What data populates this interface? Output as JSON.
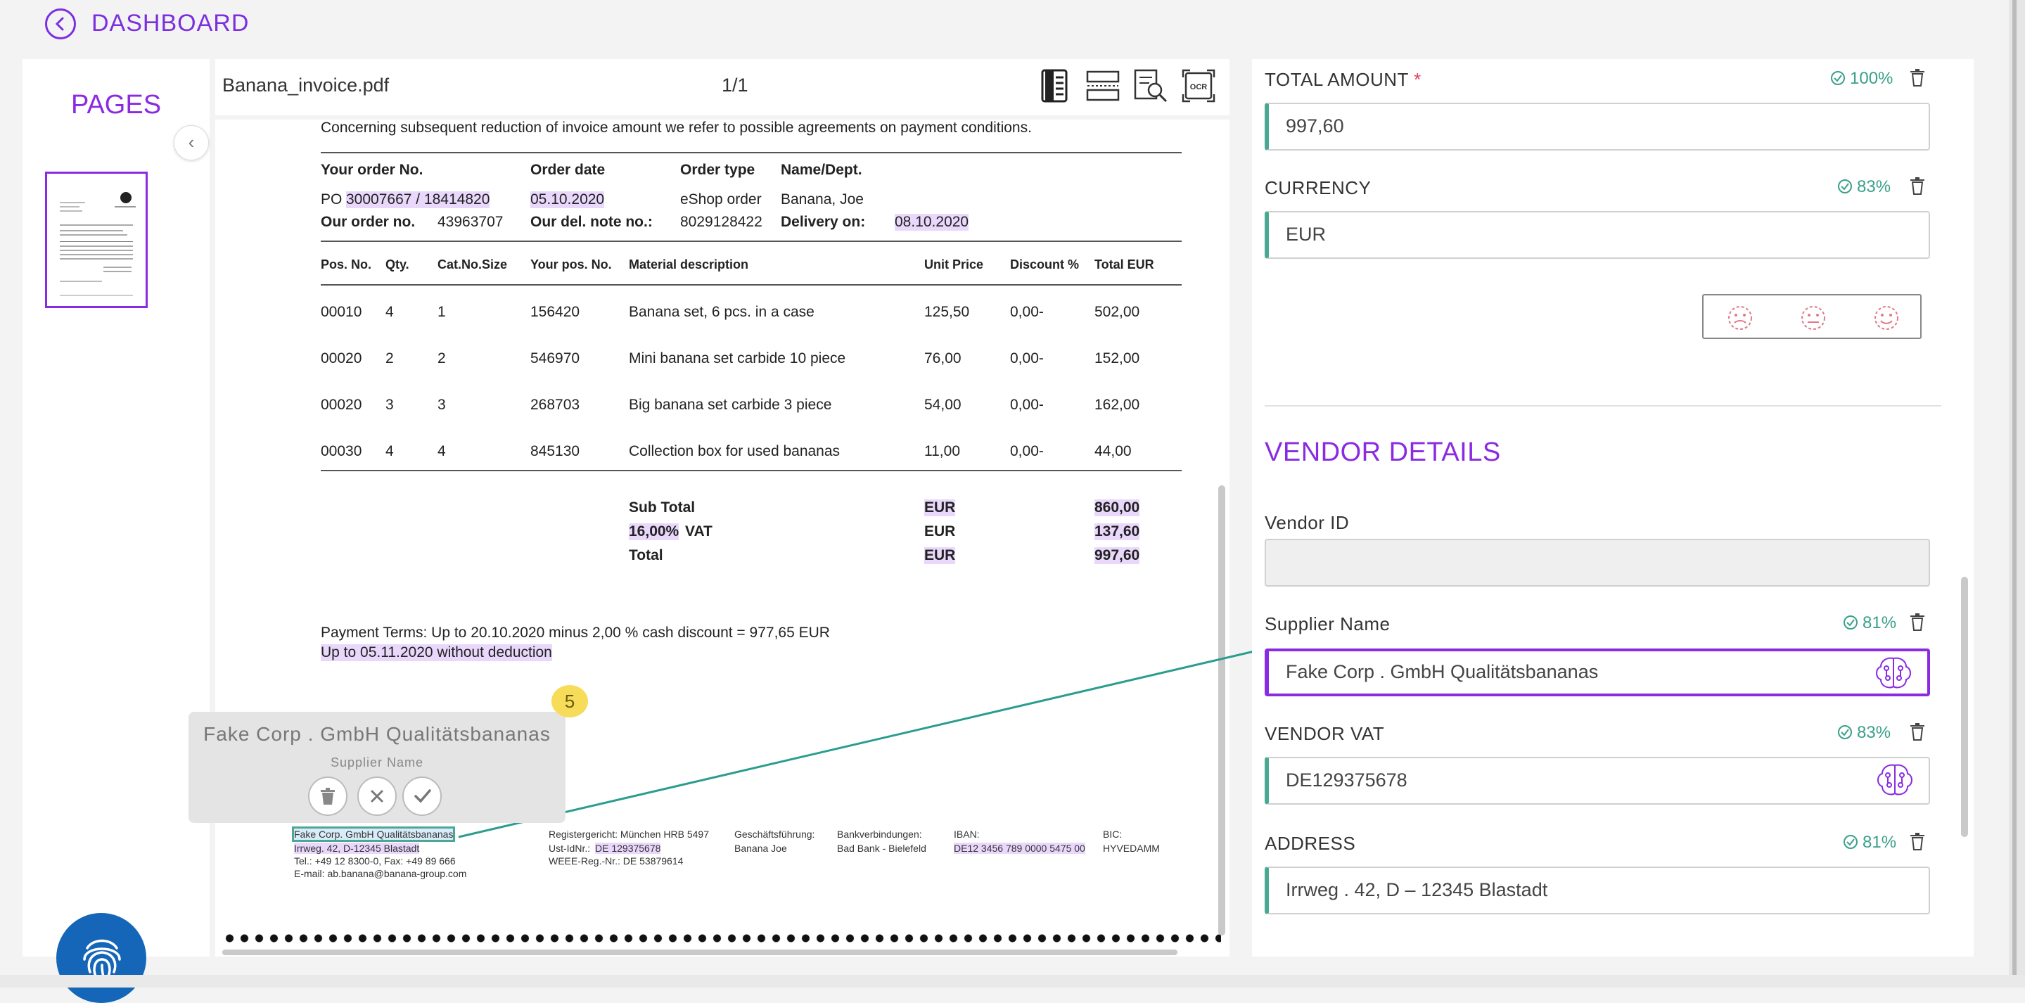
{
  "header": {
    "title": "DASHBOARD"
  },
  "pages_panel": {
    "title": "PAGES"
  },
  "viewer": {
    "file_name": "Banana_invoice.pdf",
    "page_indicator": "1/1"
  },
  "invoice": {
    "top_line": "Concerning subsequent reduction of invoice amount we refer to possible agreements on payment conditions.",
    "order_headers": [
      "Your order No.",
      "Order date",
      "Order type",
      "Name/Dept."
    ],
    "po_prefix": "PO",
    "po_value": "30007667 / 18414820",
    "order_date": "05.10.2020",
    "order_type": "eShop order",
    "name_dept": "Banana, Joe",
    "our_order_label": "Our order no.",
    "our_order_value": "43963707",
    "del_note_label": "Our del. note no.:",
    "del_note_value": "8029128422",
    "delivery_label": "Delivery on:",
    "delivery_value": "08.10.2020",
    "item_headers": [
      "Pos. No.",
      "Qty.",
      "Cat.No.Size",
      "Your pos. No.",
      "Material description",
      "Unit Price",
      "Discount %",
      "Total EUR"
    ],
    "items": [
      [
        "00010",
        "4",
        "1",
        "156420",
        "Banana set, 6 pcs. in a case",
        "125,50",
        "0,00-",
        "502,00"
      ],
      [
        "00020",
        "2",
        "2",
        "546970",
        "Mini banana set carbide 10 piece",
        "76,00",
        "0,00-",
        "152,00"
      ],
      [
        "00020",
        "3",
        "3",
        "268703",
        "Big banana set carbide 3 piece",
        "54,00",
        "0,00-",
        "162,00"
      ],
      [
        "00030",
        "4",
        "4",
        "845130",
        "Collection box for used bananas",
        "11,00",
        "0,00-",
        "44,00"
      ]
    ],
    "subtotal_label": "Sub Total",
    "subtotal_cur": "EUR",
    "subtotal_value": "860,00",
    "vat_rate": "16,00%",
    "vat_label": "VAT",
    "vat_cur": "EUR",
    "vat_value": "137,60",
    "total_label": "Total",
    "total_cur": "EUR",
    "total_value": "997,60",
    "payment_terms_1": "Payment Terms: Up to 20.10.2020 minus 2,00 % cash discount = 977,65 EUR",
    "payment_terms_2": "Up to 05.11.2020 without deduction",
    "footer": {
      "company": "Fake Corp. GmbH Qualitätsbananas",
      "address": "Irrweg. 42, D-12345 Blastadt",
      "tel": "Tel.: +49 12 8300-0, Fax: +49 89 666",
      "email": "E-mail: ab.banana@banana-group.com",
      "reg1": "Registergericht: München HRB 5497",
      "reg2_prefix": "Ust-IdNr.:",
      "reg2_value": "DE 129375678",
      "reg3": "WEEE-Reg.-Nr.: DE 53879614",
      "gf_label": "Geschäftsführung:",
      "gf_value": "Banana Joe",
      "bank_label": "Bankverbindungen:",
      "bank_value": "Bad Bank - Bielefeld",
      "iban_label": "IBAN:",
      "iban_value": "DE12 3456 789 0000 5475 00",
      "bic_label": "BIC:",
      "bic_value": "HYVEDAMM"
    }
  },
  "popup": {
    "value": "Fake Corp . GmbH Qualitätsbananas",
    "label": "Supplier Name",
    "badge": "5"
  },
  "fields": {
    "total_amount": {
      "label": "TOTAL AMOUNT",
      "required": "*",
      "confidence": "100%",
      "value": "997,60"
    },
    "currency": {
      "label": "CURRENCY",
      "confidence": "83%",
      "value": "EUR"
    },
    "vendor_heading": "VENDOR DETAILS",
    "vendor_id": {
      "label": "Vendor ID",
      "value": ""
    },
    "supplier_name": {
      "label": "Supplier Name",
      "confidence": "81%",
      "value": "Fake Corp . GmbH Qualitätsbananas"
    },
    "vendor_vat": {
      "label": "VENDOR VAT",
      "confidence": "83%",
      "value": "DE129375678"
    },
    "address": {
      "label": "ADDRESS",
      "confidence": "81%",
      "value": "Irrweg . 42, D – 12345 Blastadt"
    }
  },
  "colors": {
    "accent": "#8a2be2",
    "teal": "#4aa893",
    "confidence": "#3aa08a",
    "highlight": "#e9d8fb",
    "fingerprint": "#1566b8"
  },
  "icons": [
    "back-chevron-icon",
    "thumbnail-view-icon",
    "fit-width-icon",
    "search-document-icon",
    "ocr-icon",
    "trash-icon",
    "close-icon",
    "check-icon",
    "check-circle-icon",
    "ai-brain-icon",
    "emoji-face-icon",
    "fingerprint-icon"
  ]
}
